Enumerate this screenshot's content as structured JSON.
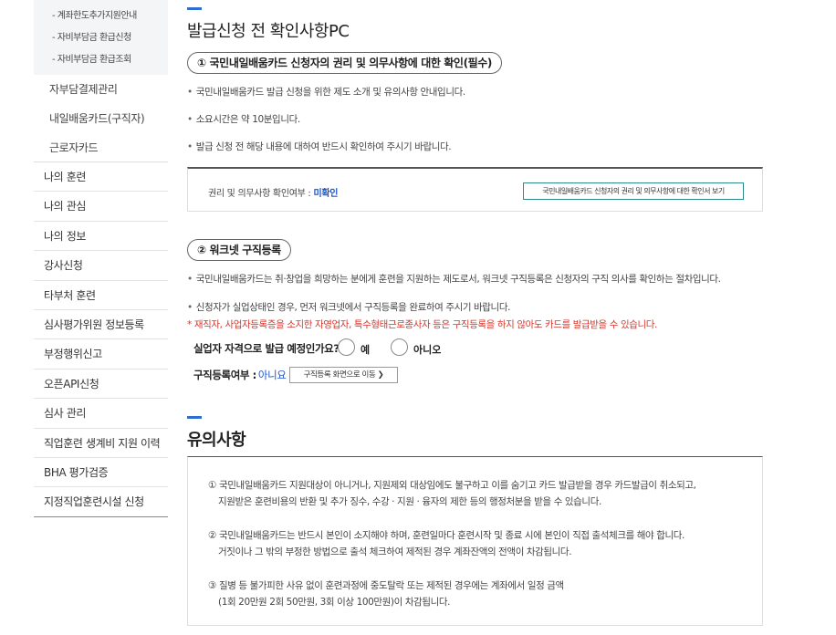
{
  "sidebar": {
    "sub_items": [
      "- 계좌한도추가지원안내",
      "- 자비부담금 환급신청",
      "- 자비부담금 환급조회"
    ],
    "level2_items": [
      "자부담결제관리",
      "내일배움카드(구직자)",
      "근로자카드"
    ],
    "level1_items": [
      "나의 훈련",
      "나의 관심",
      "나의 정보",
      "강사신청",
      "타부처 훈련",
      "심사평가위원 정보등록",
      "부정행위신고",
      "오픈API신청",
      "심사 관리",
      "직업훈련 생계비 지원 이력",
      "BHA 평가검증",
      "지정직업훈련시설 신청"
    ]
  },
  "main": {
    "page_title": "발급신청 전 확인사항PC",
    "section1": {
      "heading": "① 국민내일배움카드 신청자의 권리 및 의무사항에 대한 확인(필수)",
      "bullets": [
        "국민내일배움카드 발급 신청을 위한 제도 소개 및 유의사항 안내입니다.",
        "소요시간은 약 10분입니다.",
        "발급 신청 전 해당 내용에 대하여 반드시 확인하여 주시기 바랍니다."
      ],
      "check_label": "권리 및 의무사항 확인여부 :",
      "check_status": "미확인",
      "view_button": "국민내일배움카드 신청자의 권리 및 의무사항에 대한 확인서 보기"
    },
    "section2": {
      "heading": "② 워크넷 구직등록",
      "bullets": [
        "국민내일배움카드는 취·창업을 희망하는 분에게 훈련을 지원하는 제도로서, 워크넷 구직등록은 신청자의 구직 의사를 확인하는 절차입니다.",
        "신청자가 실업상태인 경우, 먼저 워크넷에서 구직등록을 완료하여 주시기 바랍니다."
      ],
      "warning": "재직자, 사업자등록증을 소지한 자영업자, 특수형태근로종사자 등은 구직등록을 하지 않아도 카드를 발급받을 수 있습니다.",
      "question": "실업자 자격으로 발급 예정인가요?",
      "option_yes": "예",
      "option_no": "아니오",
      "reg_label": "구직등록여부 :",
      "reg_status": "아니요",
      "move_button": "구직등록 화면으로 이동 ❯"
    },
    "notice": {
      "title": "유의사항",
      "items": [
        {
          "line1": "① 국민내일배움카드 지원대상이 아니거나, 지원제외 대상임에도 불구하고 이를 숨기고 카드 발급받을 경우 카드발급이 취소되고,",
          "line2": "지원받은 훈련비용의 반환 및 추가 징수, 수강 · 지원 · 융자의 제한 등의 행정처분을 받을 수 있습니다."
        },
        {
          "line1": "② 국민내일배움카드는 반드시 본인이 소지해야 하며, 훈련일마다 훈련시작 및 종료 시에 본인이 직접 출석체크를 해야 합니다.",
          "line2": "거짓이나 그 밖의 부정한 방법으로 출석 체크하여 제적된 경우 계좌잔액의 전액이 차감됩니다."
        },
        {
          "line1": "③ 질병 등 불가피한 사유 없이 훈련과정에 중도탈락 또는 제적된 경우에는 계좌에서 일정 금액",
          "line2": "(1회 20만원 2회 50만원, 3회 이상 100만원)이 차감됩니다."
        }
      ]
    }
  },
  "colors": {
    "accent": "#2c6ed5",
    "status_blue": "#1e56c6",
    "warning_red": "#d8352b",
    "button_border": "#2f8a8a"
  }
}
